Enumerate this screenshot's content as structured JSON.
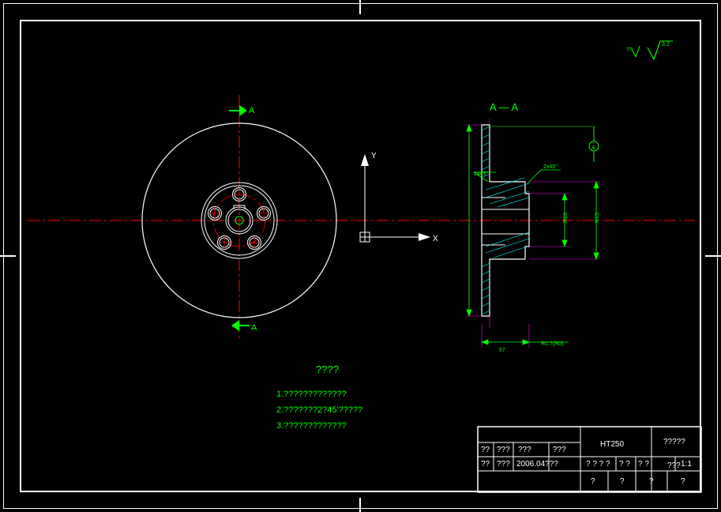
{
  "section_label": "A — A",
  "axes": {
    "x": "X",
    "y": "Y"
  },
  "notes_title": "????",
  "notes": [
    "1.?????????????",
    "2.???????2?45'?????",
    "3.?????????????"
  ],
  "section_marks": {
    "top": "A",
    "bottom": "A"
  },
  "dimensions": {
    "d1": "2x45°",
    "d2": "2x45°",
    "r1": "R10",
    "r2": "R15",
    "ext1": "57",
    "ext2": "R0.7(R0)",
    "datum": "A"
  },
  "surface_finish": "3.2",
  "title_block": {
    "material": "HT250",
    "part_name": "?????",
    "drawing_no": "???",
    "cells": {
      "c1": "??",
      "c2": "???",
      "c3": "???",
      "c4": "???",
      "c5": "??",
      "c6": "???",
      "c7": "2006.04???",
      "c8": "? ? ? ?",
      "c9": "? ?",
      "c10": "? ?",
      "c11": "1:1",
      "c12": "?",
      "c13": "?",
      "c14": "?",
      "c15": "?"
    }
  }
}
